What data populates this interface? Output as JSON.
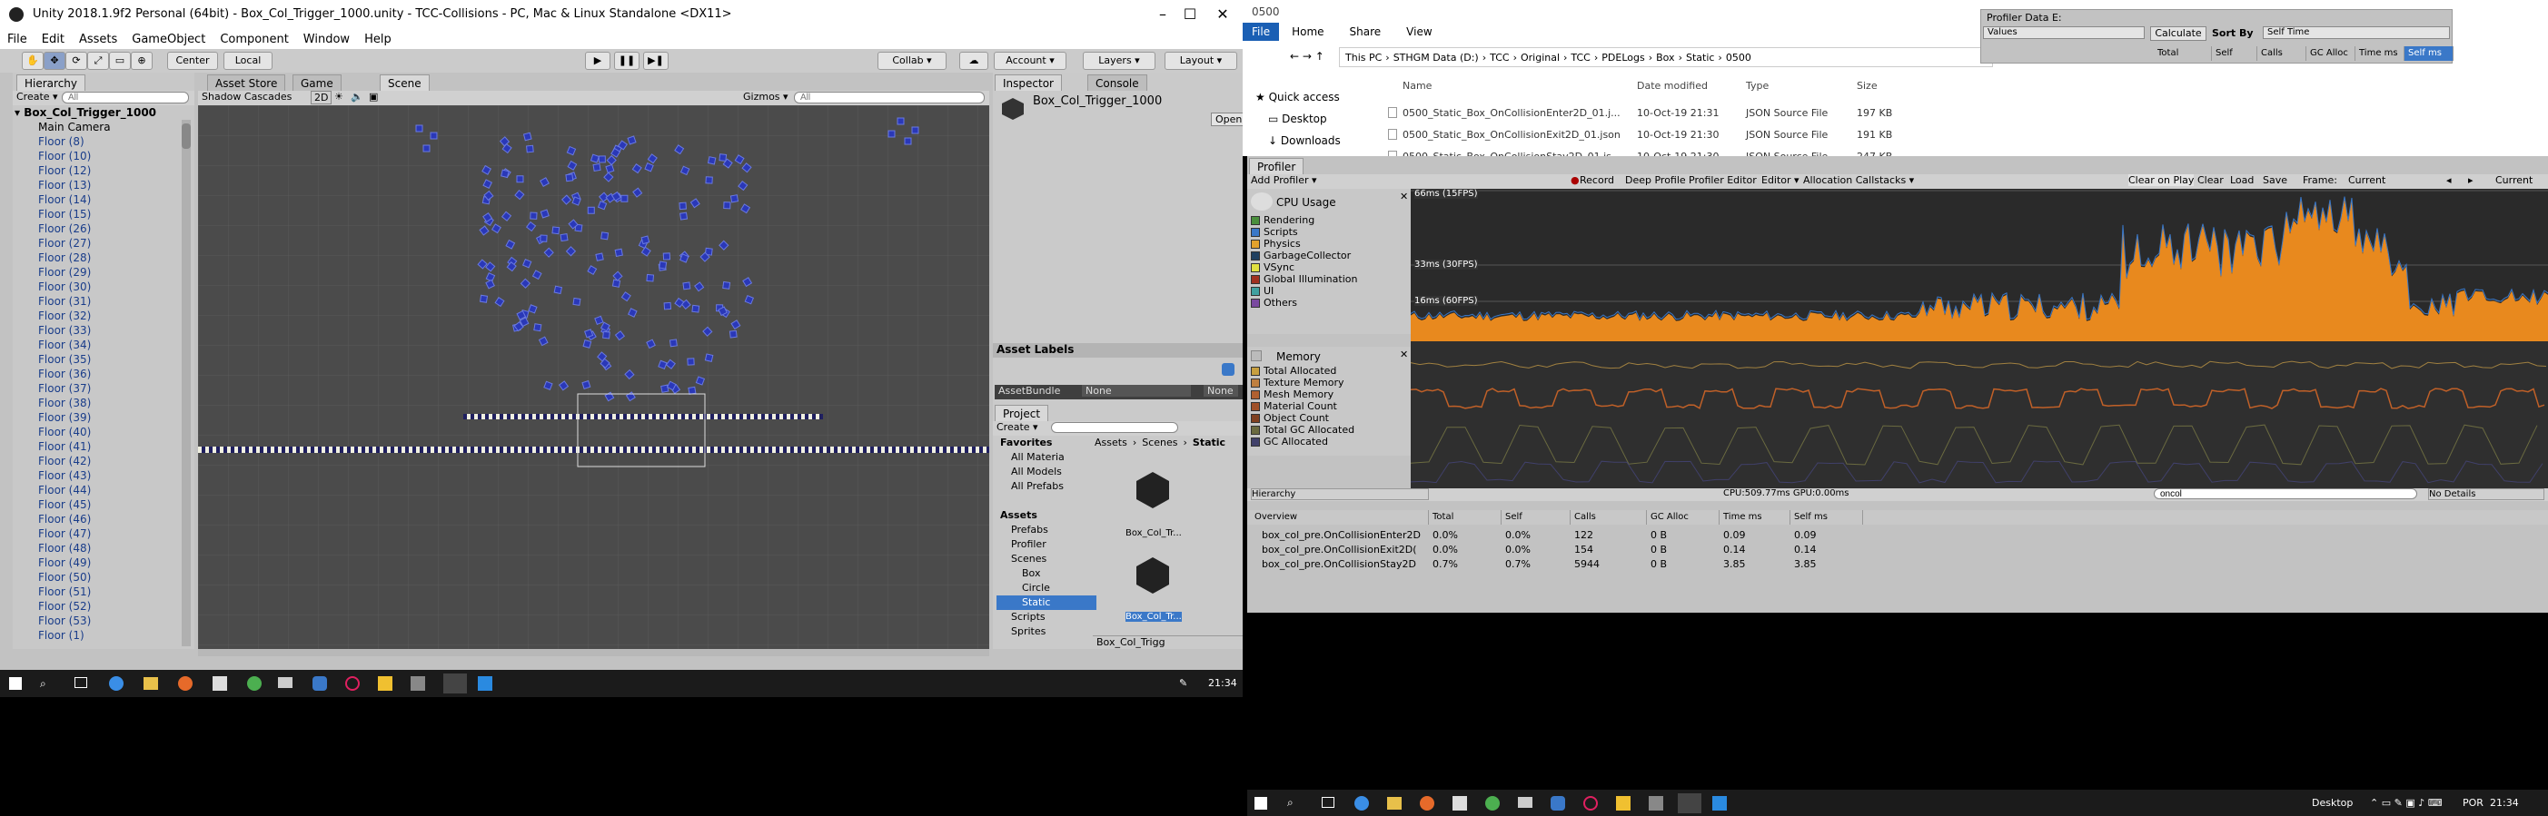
{
  "unity": {
    "title": "Unity 2018.1.9f2 Personal (64bit) - Box_Col_Trigger_1000.unity - TCC-Collisions - PC, Mac & Linux Standalone <DX11>",
    "menu": [
      "File",
      "Edit",
      "Assets",
      "GameObject",
      "Component",
      "Window",
      "Help"
    ],
    "toolbar": {
      "center": "Center",
      "local": "Local",
      "collab": "Collab ▾",
      "account": "Account ▾",
      "layers": "Layers ▾",
      "layout": "Layout ▾"
    },
    "tabs": {
      "hierarchy": "Hierarchy",
      "asset_store": "Asset Store",
      "game": "Game",
      "scene": "Scene",
      "inspector": "Inspector",
      "console": "Console"
    },
    "hierarchy": {
      "create": "Create ▾",
      "search_placeholder": "All",
      "root": "Box_Col_Trigger_1000",
      "items": [
        "Main Camera",
        "Floor (8)",
        "Floor (10)",
        "Floor (12)",
        "Floor (13)",
        "Floor (14)",
        "Floor (15)",
        "Floor (26)",
        "Floor (27)",
        "Floor (28)",
        "Floor (29)",
        "Floor (30)",
        "Floor (31)",
        "Floor (32)",
        "Floor (33)",
        "Floor (34)",
        "Floor (35)",
        "Floor (36)",
        "Floor (37)",
        "Floor (38)",
        "Floor (39)",
        "Floor (40)",
        "Floor (41)",
        "Floor (42)",
        "Floor (43)",
        "Floor (44)",
        "Floor (45)",
        "Floor (46)",
        "Floor (47)",
        "Floor (48)",
        "Floor (49)",
        "Floor (50)",
        "Floor (51)",
        "Floor (52)",
        "Floor (53)",
        "Floor (1)"
      ]
    },
    "scene": {
      "shading": "Shadow Cascades",
      "mode2d": "2D",
      "gizmos": "Gizmos ▾",
      "search_placeholder": "All"
    },
    "inspector": {
      "object_name": "Box_Col_Trigger_1000",
      "open": "Open"
    },
    "asset_labels": {
      "title": "Asset Labels",
      "assetbundle_label": "AssetBundle",
      "none1": "None",
      "none2": "None"
    },
    "project": {
      "tab": "Project",
      "create": "Create ▾",
      "breadcrumb": [
        "Assets",
        "Scenes",
        "Static"
      ],
      "tree": [
        {
          "label": "Favorites",
          "bold": true,
          "indent": 0
        },
        {
          "label": "All Materia",
          "bold": false,
          "indent": 1
        },
        {
          "label": "All Models",
          "bold": false,
          "indent": 1
        },
        {
          "label": "All Prefabs",
          "bold": false,
          "indent": 1
        },
        {
          "label": "",
          "bold": false,
          "indent": 0
        },
        {
          "label": "Assets",
          "bold": true,
          "indent": 0
        },
        {
          "label": "Prefabs",
          "bold": false,
          "indent": 1
        },
        {
          "label": "Profiler",
          "bold": false,
          "indent": 1
        },
        {
          "label": "Scenes",
          "bold": false,
          "indent": 1
        },
        {
          "label": "Box",
          "bold": false,
          "indent": 2
        },
        {
          "label": "Circle",
          "bold": false,
          "indent": 2
        },
        {
          "label": "Static",
          "bold": false,
          "indent": 2
        },
        {
          "label": "Scripts",
          "bold": false,
          "indent": 1
        },
        {
          "label": "Sprites",
          "bold": false,
          "indent": 1
        }
      ],
      "files": [
        "Box_Col_Tr...",
        "Box_Col_Tr..."
      ],
      "footer": "Box_Col_Trigg"
    },
    "clock": "21:34"
  },
  "explorer": {
    "ribbon": [
      "File",
      "Home",
      "Share",
      "View"
    ],
    "title": "0500",
    "path": [
      "This PC",
      "STHGM Data (D:)",
      "TCC",
      "Original",
      "TCC",
      "PDELogs",
      "Box",
      "Static",
      "0500"
    ],
    "nav": [
      "Quick access",
      "Desktop",
      "Downloads"
    ],
    "columns": [
      "Name",
      "Date modified",
      "Type",
      "Size"
    ],
    "rows": [
      {
        "name": "0500_Static_Box_OnCollisionEnter2D_01.j...",
        "date": "10-Oct-19 21:31",
        "type": "JSON Source File",
        "size": "197 KB"
      },
      {
        "name": "0500_Static_Box_OnCollisionExit2D_01.json",
        "date": "10-Oct-19 21:30",
        "type": "JSON Source File",
        "size": "191 KB"
      },
      {
        "name": "0500_Static_Box_OnCollisionStay2D_01.js...",
        "date": "10-Oct-19 21:30",
        "type": "JSON Source File",
        "size": "247 KB"
      }
    ]
  },
  "profiler_data_editor": {
    "title": "Profiler Data E:",
    "values": "Values",
    "calculate": "Calculate",
    "sort_by": "Sort By",
    "sort_value": "Self Time",
    "headers": [
      "Total",
      "Self",
      "Calls",
      "GC Alloc",
      "Time ms",
      "Self ms"
    ]
  },
  "profiler": {
    "tab": "Profiler",
    "add_profiler": "Add Profiler ▾",
    "toolbar": [
      "Record",
      "Deep Profile",
      "Profiler Editor",
      "Editor ▾",
      "Allocation Callstacks ▾"
    ],
    "toolbar_right": [
      "Clear on Play",
      "Clear",
      "Load",
      "Save",
      "Frame:",
      "Current"
    ],
    "cpu_title": "CPU Usage",
    "cpu_legend": [
      {
        "label": "Rendering",
        "color": "#4a8f3c"
      },
      {
        "label": "Scripts",
        "color": "#3a78c8"
      },
      {
        "label": "Physics",
        "color": "#e3a22d"
      },
      {
        "label": "GarbageCollector",
        "color": "#204060"
      },
      {
        "label": "VSync",
        "color": "#e0e040"
      },
      {
        "label": "Global Illumination",
        "color": "#a03020"
      },
      {
        "label": "UI",
        "color": "#40a0a0"
      },
      {
        "label": "Others",
        "color": "#7a4aa0"
      }
    ],
    "cpu_markers": [
      "66ms (15FPS)",
      "33ms (30FPS)",
      "16ms (60FPS)"
    ],
    "memory_title": "Memory",
    "memory_legend": [
      {
        "label": "Total Allocated",
        "color": "#c8a040"
      },
      {
        "label": "Texture Memory",
        "color": "#c08040"
      },
      {
        "label": "Mesh Memory",
        "color": "#b06030"
      },
      {
        "label": "Material Count",
        "color": "#a05028"
      },
      {
        "label": "Object Count",
        "color": "#804020"
      },
      {
        "label": "Total GC Allocated",
        "color": "#6a6a40"
      },
      {
        "label": "GC Allocated",
        "color": "#40406a"
      }
    ],
    "hierarchy_mode": "Hierarchy",
    "cpu_stat": "CPU:509.77ms  GPU:0.00ms",
    "search_value": "oncol",
    "details": "No Details",
    "table_headers": [
      "Overview",
      "Total",
      "Self",
      "Calls",
      "GC Alloc",
      "Time ms",
      "Self ms"
    ],
    "rows": [
      {
        "name": "box_col_pre.OnCollisionEnter2D",
        "total": "0.0%",
        "self": "0.0%",
        "calls": "122",
        "gc": "0 B",
        "time": "0.09",
        "selfms": "0.09"
      },
      {
        "name": "box_col_pre.OnCollisionExit2D(",
        "total": "0.0%",
        "self": "0.0%",
        "calls": "154",
        "gc": "0 B",
        "time": "0.14",
        "selfms": "0.14"
      },
      {
        "name": "box_col_pre.OnCollisionStay2D",
        "total": "0.7%",
        "self": "0.7%",
        "calls": "5944",
        "gc": "0 B",
        "time": "3.85",
        "selfms": "3.85"
      }
    ]
  },
  "taskbar_right": {
    "desktop": "Desktop",
    "lang": "POR",
    "clock": "21:34"
  }
}
